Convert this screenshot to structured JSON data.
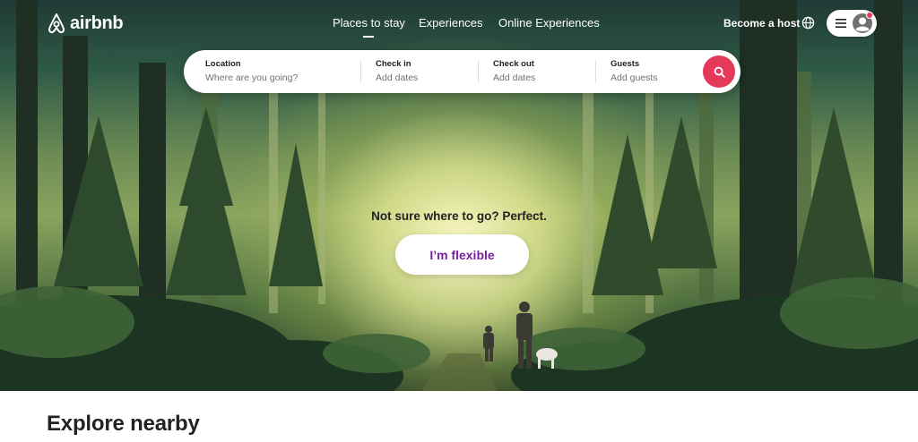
{
  "brand": {
    "name": "airbnb",
    "accent": "#E5395A",
    "flexible_color": "#7B1FA2"
  },
  "nav": {
    "tabs": [
      {
        "label": "Places to stay",
        "active": true
      },
      {
        "label": "Experiences",
        "active": false
      },
      {
        "label": "Online Experiences",
        "active": false
      }
    ],
    "host_label": "Become a host",
    "globe_icon": "globe-icon",
    "menu_icon": "hamburger-icon",
    "avatar_icon": "user-avatar-icon"
  },
  "search": {
    "fields": [
      {
        "label": "Location",
        "placeholder": "Where are you going?"
      },
      {
        "label": "Check in",
        "placeholder": "Add dates"
      },
      {
        "label": "Check out",
        "placeholder": "Add dates"
      },
      {
        "label": "Guests",
        "placeholder": "Add guests"
      }
    ],
    "button_icon": "search-icon"
  },
  "hero": {
    "prompt": "Not sure where to go? Perfect.",
    "button_label": "I’m flexible"
  },
  "explore": {
    "title": "Explore nearby"
  }
}
